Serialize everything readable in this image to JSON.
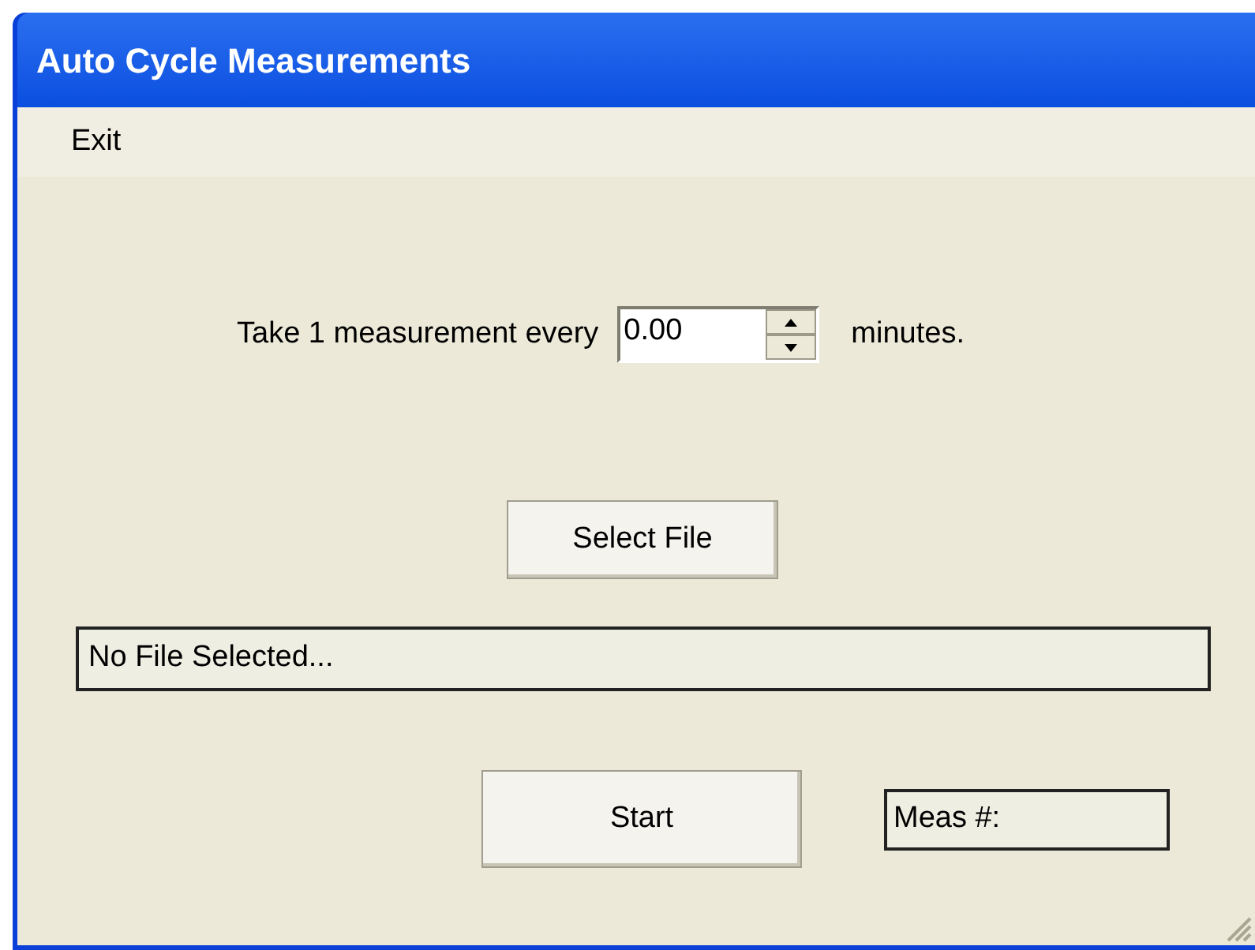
{
  "window": {
    "title": "Auto Cycle Measurements"
  },
  "menu": [
    "Exit"
  ],
  "interval": {
    "prefix": "Take 1 measurement every",
    "value": "0.00",
    "suffix": "minutes."
  },
  "select_button": "Select File",
  "file_status": "No File Selected...",
  "start_button": "Start",
  "meas_label": "Meas #:"
}
